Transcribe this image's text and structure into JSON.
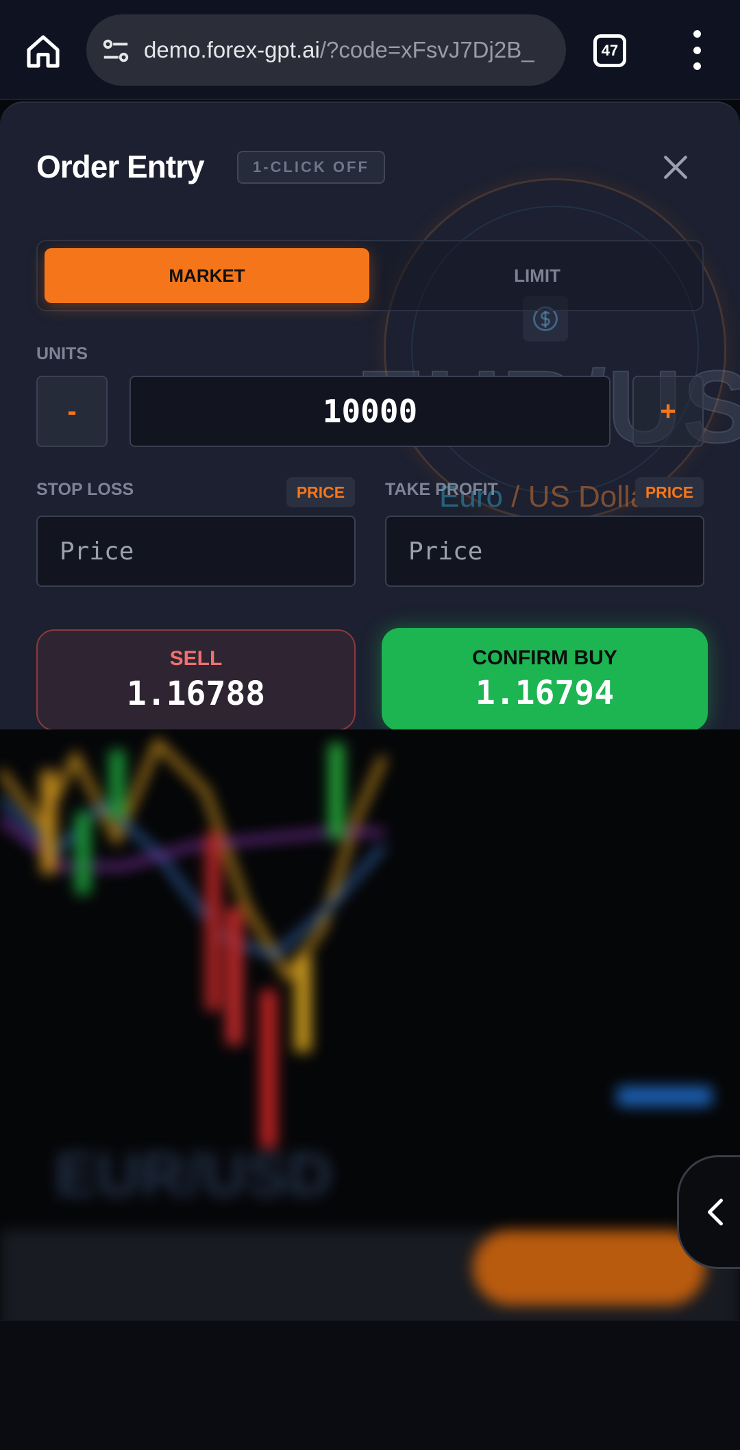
{
  "browser": {
    "url_domain": "demo.forex-gpt.ai",
    "url_path": "/?code=xFsvJ7Dj2B_",
    "tab_count": "47"
  },
  "order_entry": {
    "title": "Order Entry",
    "one_click": "1-CLICK OFF",
    "order_types": [
      "MARKET",
      "LIMIT"
    ],
    "selected_order_type": "MARKET",
    "units_label": "UNITS",
    "units_value": "10000",
    "minus_label": "-",
    "plus_label": "+",
    "stop_loss": {
      "label": "STOP LOSS",
      "mode": "PRICE",
      "placeholder": "Price"
    },
    "take_profit": {
      "label": "TAKE PROFIT",
      "mode": "PRICE",
      "placeholder": "Price"
    },
    "sell": {
      "label": "SELL",
      "price": "1.16788"
    },
    "buy": {
      "label": "CONFIRM BUY",
      "price": "1.16794"
    }
  },
  "instrument": {
    "symbol": "EUR/USD",
    "base_name": "Euro",
    "separator": "/",
    "quote_name": "US Dollar"
  },
  "colors": {
    "accent": "#f5761a",
    "buy": "#1db452",
    "sell_text": "#f07070",
    "panel": "#1c2030"
  }
}
